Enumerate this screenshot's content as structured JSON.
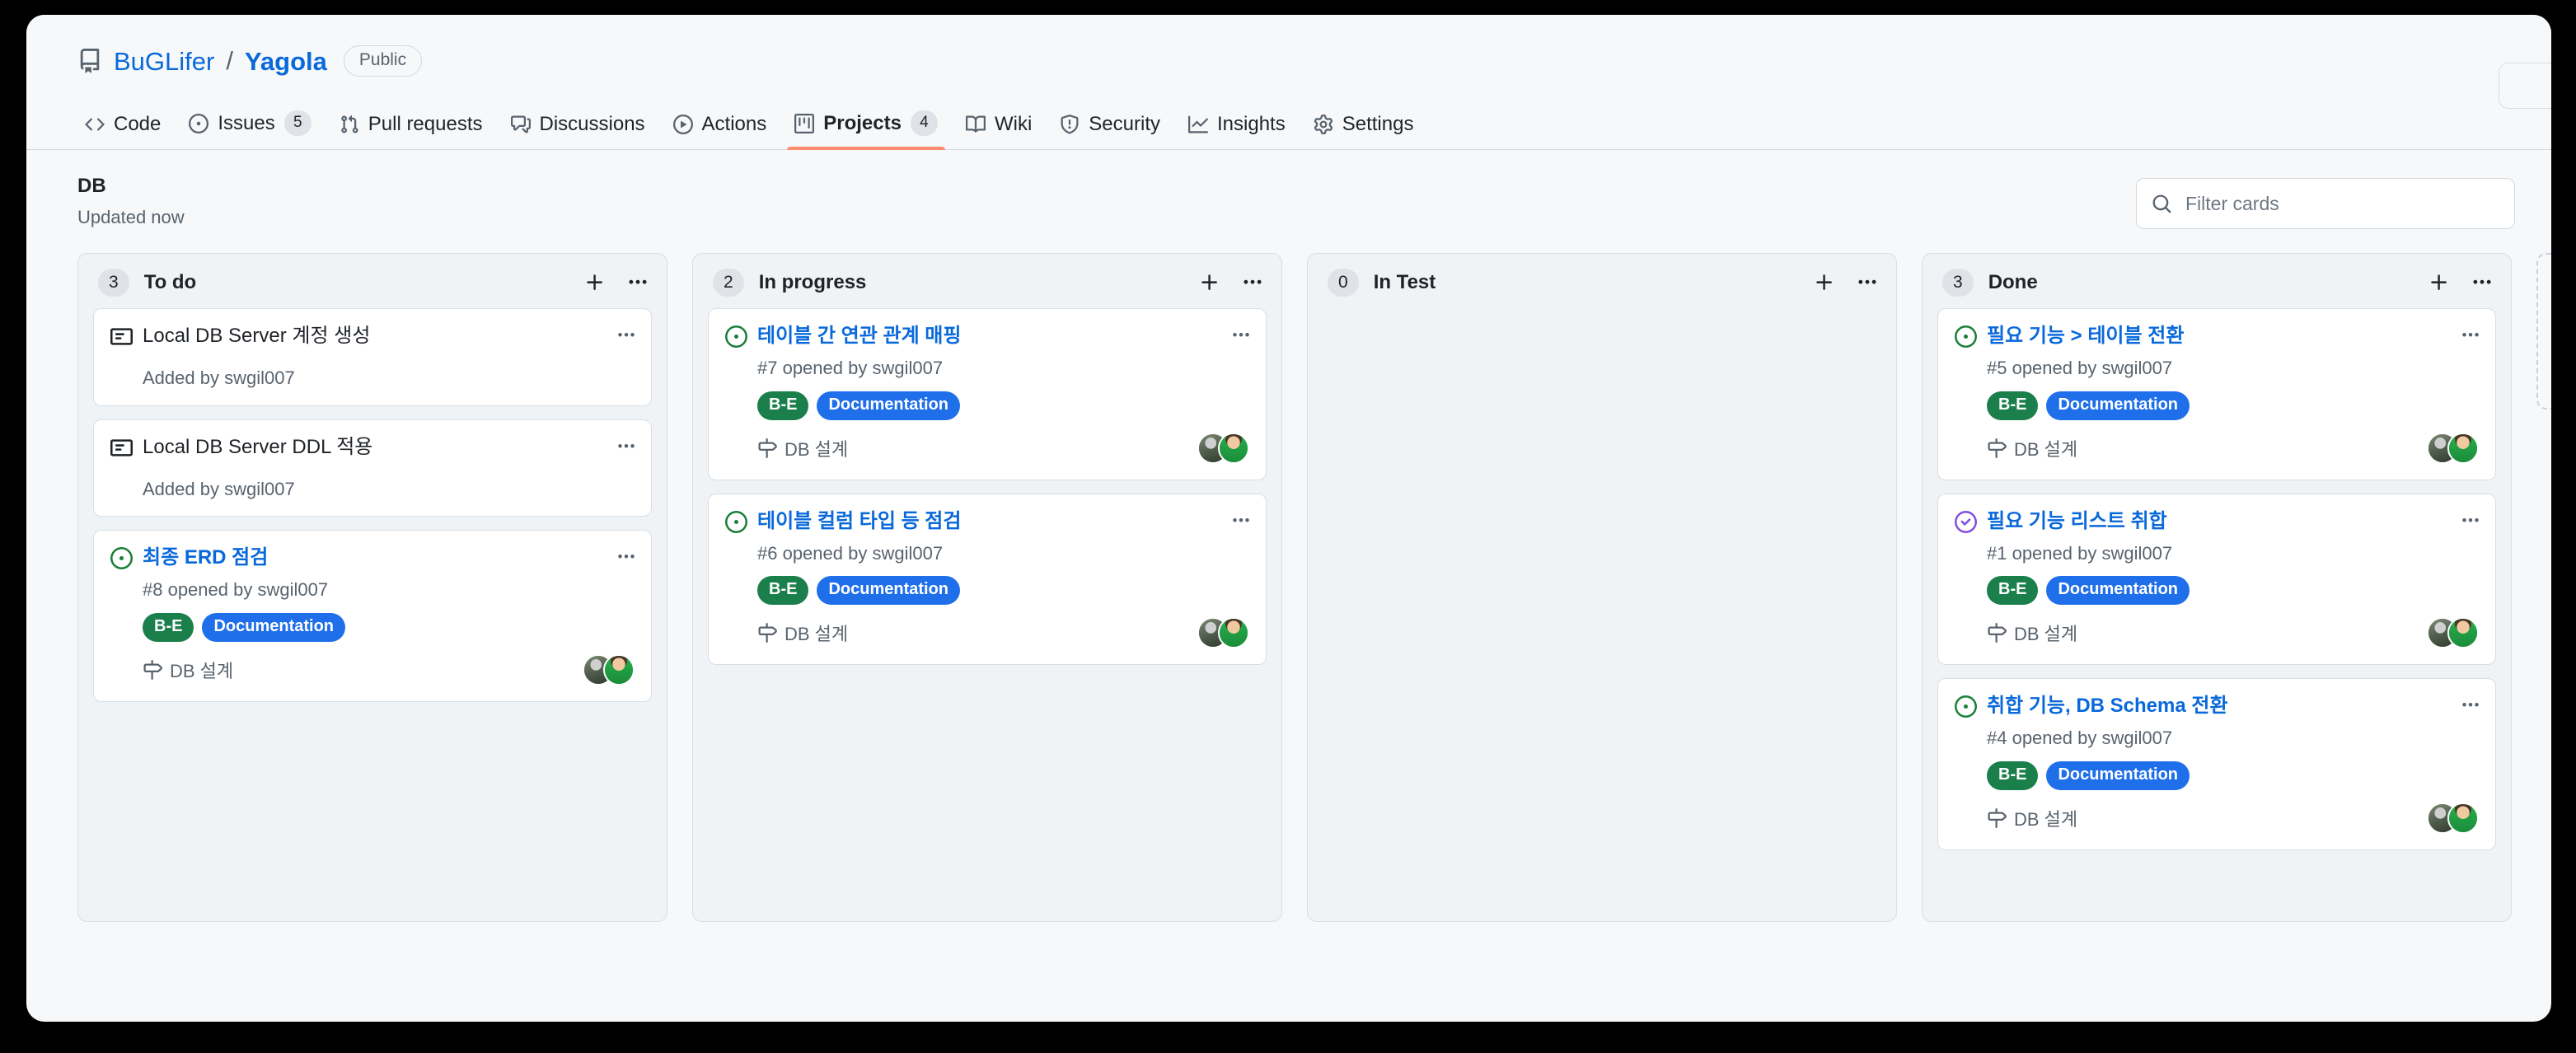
{
  "repo": {
    "owner": "BuGLifer",
    "separator": "/",
    "name": "Yagola",
    "visibility": "Public",
    "icon": "repo-icon"
  },
  "nav": {
    "items": [
      {
        "label": "Code",
        "icon": "code-icon",
        "count": null,
        "selected": false
      },
      {
        "label": "Issues",
        "icon": "issue-opened-icon",
        "count": "5",
        "selected": false
      },
      {
        "label": "Pull requests",
        "icon": "git-pull-request-icon",
        "count": null,
        "selected": false
      },
      {
        "label": "Discussions",
        "icon": "comment-discussion-icon",
        "count": null,
        "selected": false
      },
      {
        "label": "Actions",
        "icon": "play-icon",
        "count": null,
        "selected": false
      },
      {
        "label": "Projects",
        "icon": "project-icon",
        "count": "4",
        "selected": true
      },
      {
        "label": "Wiki",
        "icon": "book-icon",
        "count": null,
        "selected": false
      },
      {
        "label": "Security",
        "icon": "shield-icon",
        "count": null,
        "selected": false
      },
      {
        "label": "Insights",
        "icon": "graph-icon",
        "count": null,
        "selected": false
      },
      {
        "label": "Settings",
        "icon": "gear-icon",
        "count": null,
        "selected": false
      }
    ]
  },
  "project": {
    "title": "DB",
    "updated": "Updated now",
    "filter": {
      "placeholder": "Filter cards",
      "value": "",
      "icon": "search-icon"
    }
  },
  "colors": {
    "accent": "#0969da",
    "label_be_bg": "#1a7f4b",
    "label_documentation_bg": "#1f6feb",
    "issue_open": "#1a7f37",
    "issue_closed": "#8250df",
    "tab_underline": "#fd8c73"
  },
  "board": {
    "add_column_label": "",
    "columns": [
      {
        "name": "To do",
        "count": "3",
        "add_icon": "plus-icon",
        "menu_icon": "kebab-horizontal-icon",
        "cards": [
          {
            "type": "note",
            "state_icon": "note-icon",
            "title": "Local DB Server 계정 생성",
            "meta": "Added by swgil007",
            "labels": [],
            "milestone": null,
            "assignees": 0
          },
          {
            "type": "note",
            "state_icon": "note-icon",
            "title": "Local DB Server DDL 적용",
            "meta": "Added by swgil007",
            "labels": [],
            "milestone": null,
            "assignees": 0
          },
          {
            "type": "issue",
            "state_icon": "issue-opened-icon",
            "title": "최종 ERD 점검",
            "meta": "#8 opened by swgil007",
            "labels": [
              {
                "text": "B-E",
                "bg": "#1a7f4b"
              },
              {
                "text": "Documentation",
                "bg": "#1f6feb"
              }
            ],
            "milestone": "DB 설계",
            "assignees": 2
          }
        ]
      },
      {
        "name": "In progress",
        "count": "2",
        "add_icon": "plus-icon",
        "menu_icon": "kebab-horizontal-icon",
        "cards": [
          {
            "type": "issue",
            "state_icon": "issue-opened-icon",
            "title": "테이블 간 연관 관계 매핑",
            "meta": "#7 opened by swgil007",
            "labels": [
              {
                "text": "B-E",
                "bg": "#1a7f4b"
              },
              {
                "text": "Documentation",
                "bg": "#1f6feb"
              }
            ],
            "milestone": "DB 설계",
            "assignees": 2
          },
          {
            "type": "issue",
            "state_icon": "issue-opened-icon",
            "title": "테이블 컬럼 타입 등 점검",
            "meta": "#6 opened by swgil007",
            "labels": [
              {
                "text": "B-E",
                "bg": "#1a7f4b"
              },
              {
                "text": "Documentation",
                "bg": "#1f6feb"
              }
            ],
            "milestone": "DB 설계",
            "assignees": 2
          }
        ]
      },
      {
        "name": "In Test",
        "count": "0",
        "add_icon": "plus-icon",
        "menu_icon": "kebab-horizontal-icon",
        "cards": []
      },
      {
        "name": "Done",
        "count": "3",
        "add_icon": "plus-icon",
        "menu_icon": "kebab-horizontal-icon",
        "cards": [
          {
            "type": "issue",
            "state_icon": "issue-opened-icon",
            "title": "필요 기능 > 테이블 전환",
            "meta": "#5 opened by swgil007",
            "labels": [
              {
                "text": "B-E",
                "bg": "#1a7f4b"
              },
              {
                "text": "Documentation",
                "bg": "#1f6feb"
              }
            ],
            "milestone": "DB 설계",
            "assignees": 2
          },
          {
            "type": "issue",
            "state_icon": "issue-closed-icon",
            "title": "필요 기능 리스트 취합",
            "meta": "#1 opened by swgil007",
            "labels": [
              {
                "text": "B-E",
                "bg": "#1a7f4b"
              },
              {
                "text": "Documentation",
                "bg": "#1f6feb"
              }
            ],
            "milestone": "DB 설계",
            "assignees": 2
          },
          {
            "type": "issue",
            "state_icon": "issue-opened-icon",
            "title": "취합 기능, DB Schema 전환",
            "meta": "#4 opened by swgil007",
            "labels": [
              {
                "text": "B-E",
                "bg": "#1a7f4b"
              },
              {
                "text": "Documentation",
                "bg": "#1f6feb"
              }
            ],
            "milestone": "DB 설계",
            "assignees": 2
          }
        ]
      }
    ]
  }
}
